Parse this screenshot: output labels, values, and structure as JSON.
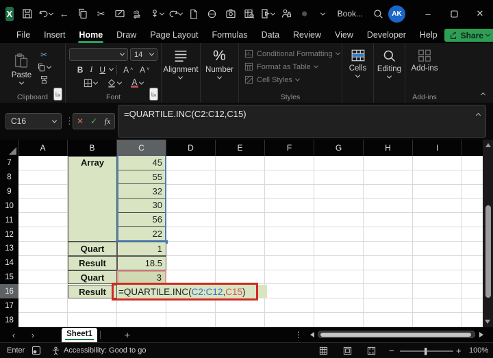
{
  "title_bar": {
    "workbook_name": "Book...",
    "avatar_initials": "AK",
    "icons": [
      "excel-logo",
      "save",
      "undo",
      "back",
      "copy",
      "cut",
      "draft-email",
      "find-and-replace",
      "touch-mode",
      "redo",
      "new-file",
      "no-fill",
      "camera",
      "preview-table",
      "export",
      "permissions-lock",
      "pen-color",
      "toolbar-overflow",
      "search"
    ]
  },
  "ribbon_tabs": {
    "items": [
      "File",
      "Insert",
      "Home",
      "Draw",
      "Page Layout",
      "Formulas",
      "Data",
      "Review",
      "View",
      "Developer",
      "Help"
    ],
    "active": "Home",
    "share_label": "Share"
  },
  "ribbon": {
    "clipboard": {
      "paste_label": "Paste",
      "group_label": "Clipboard"
    },
    "font": {
      "bold": "B",
      "italic": "I",
      "underline": "U",
      "font_size": "14",
      "group_label": "Font"
    },
    "alignment": {
      "label": "Alignment"
    },
    "number": {
      "label": "Number"
    },
    "styles": {
      "items": [
        "Conditional Formatting",
        "Format as Table",
        "Cell Styles"
      ],
      "group_label": "Styles"
    },
    "cells": {
      "label": "Cells"
    },
    "editing": {
      "label": "Editing"
    },
    "addins": {
      "label": "Add-ins",
      "group_label": "Add-ins"
    }
  },
  "formula_bar": {
    "name_box": "C16",
    "fx_label": "fx",
    "formula": "=QUARTILE.INC(C2:C12,C15)"
  },
  "sheet": {
    "col_headers": [
      "A",
      "B",
      "C",
      "D",
      "E",
      "F",
      "G",
      "H",
      "I"
    ],
    "selected_col": "C",
    "row_headers": [
      "7",
      "8",
      "9",
      "10",
      "11",
      "12",
      "13",
      "14",
      "15",
      "16",
      "17",
      "18"
    ],
    "selected_row": "16",
    "cells": {
      "B7": "Array",
      "C7": "45",
      "C8": "55",
      "C9": "32",
      "C10": "30",
      "C11": "56",
      "C12": "22",
      "B13": "Quart",
      "C13": "1",
      "B14": "Result",
      "C14": "18.5",
      "B15": "Quart",
      "C15": "3",
      "B16": "Result"
    },
    "edit_formula": {
      "prefix": "=QUARTILE.INC(",
      "range_ref": "C2:C12",
      "separator": ",",
      "cell_ref": "C15",
      "suffix": ")"
    },
    "colors": {
      "cell_green": "#d9e5c2",
      "range_blue": "#4a7ebb",
      "ref_red_border": "#e8938f",
      "edit_red": "#cf2a24",
      "formula_blue": "#2f6fc3",
      "formula_red": "#d0564a"
    }
  },
  "sheet_tabs": {
    "active_sheet": "Sheet1"
  },
  "status_bar": {
    "mode": "Enter",
    "accessibility_text": "Accessibility: Good to go",
    "zoom_level": "100%"
  }
}
